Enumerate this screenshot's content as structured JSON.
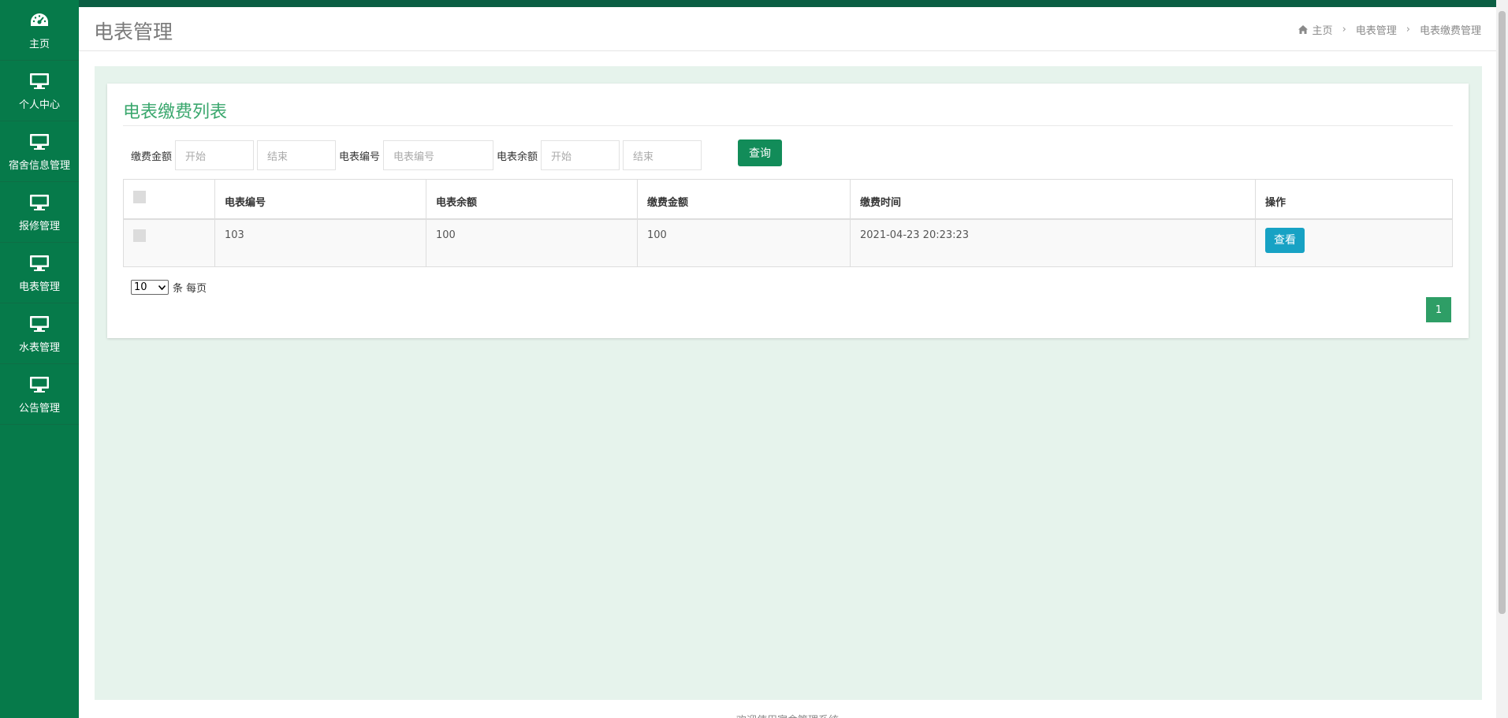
{
  "sidebar": {
    "items": [
      {
        "label": "主页",
        "icon": "dashboard-icon"
      },
      {
        "label": "个人中心",
        "icon": "monitor-icon"
      },
      {
        "label": "宿舍信息管理",
        "icon": "monitor-icon"
      },
      {
        "label": "报修管理",
        "icon": "monitor-icon"
      },
      {
        "label": "电表管理",
        "icon": "monitor-icon"
      },
      {
        "label": "水表管理",
        "icon": "monitor-icon"
      },
      {
        "label": "公告管理",
        "icon": "monitor-icon"
      }
    ]
  },
  "header": {
    "title": "电表管理",
    "breadcrumb": [
      "主页",
      "电表管理",
      "电表缴费管理"
    ]
  },
  "panel": {
    "title": "电表缴费列表"
  },
  "filters": {
    "amount_label": "缴费金额",
    "amount_start_placeholder": "开始",
    "amount_end_placeholder": "结束",
    "meter_label": "电表编号",
    "meter_placeholder": "电表编号",
    "balance_label": "电表余额",
    "balance_start_placeholder": "开始",
    "balance_end_placeholder": "结束",
    "query_label": "查询"
  },
  "table": {
    "columns": [
      "电表编号",
      "电表余额",
      "缴费金额",
      "缴费时间",
      "操作"
    ],
    "rows": [
      {
        "meter_no": "103",
        "balance": "100",
        "amount": "100",
        "time": "2021-04-23 20:23:23",
        "action": "查看"
      }
    ]
  },
  "pagination": {
    "page_size": "10",
    "page_size_suffix": "条 每页",
    "current_page": "1"
  },
  "footer": {
    "text": "欢迎使用宿舍管理系统"
  },
  "colors": {
    "sidebar": "#067a4a",
    "accent": "#3aa76d",
    "query_button": "#128c59",
    "view_button": "#17a2c4",
    "content_bg": "#e6f3ec"
  }
}
